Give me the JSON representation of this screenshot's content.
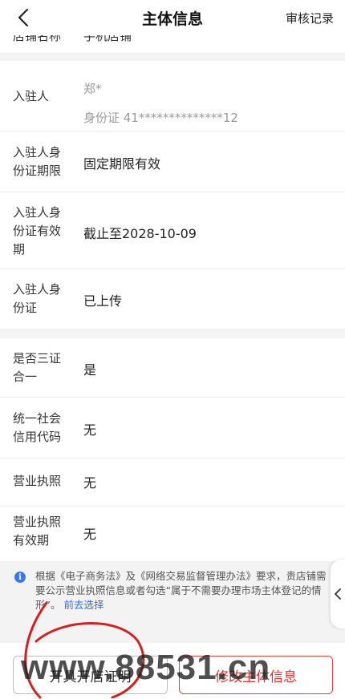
{
  "header": {
    "title": "主体信息",
    "audit_label": "审核记录"
  },
  "top_partial": {
    "label": "店铺名称",
    "value": "手机店铺"
  },
  "applicant": {
    "label": "入驻人",
    "name": "郑*",
    "id_info": "身份证 41**************12"
  },
  "id_validity_type": {
    "label": "入驻人身份证期限",
    "value": "固定期限有效"
  },
  "id_valid_until": {
    "label": "入驻人身份证有效期",
    "value": "截止至2028-10-09"
  },
  "id_card": {
    "label": "入驻人身份证",
    "value": "已上传"
  },
  "three_in_one": {
    "label": "是否三证合一",
    "value": "是"
  },
  "credit_code": {
    "label": "统一社会信用代码",
    "value": "无"
  },
  "business_license": {
    "label": "营业执照",
    "value": "无"
  },
  "license_validity": {
    "label": "营业执照有效期",
    "value": "无"
  },
  "notice": {
    "text": "根据《电子商务法》及《网络交易监督管理办法》要求，贵店铺需要公示营业执照信息或者勾选“属于不需要办理市场主体登记的情形”。",
    "link": "前去选择"
  },
  "buttons": {
    "left": "开具开店证明",
    "right": "修改主体信息"
  },
  "watermark": "www.88531.cn",
  "colors": {
    "accent_red": "#e03030",
    "link_blue": "#2f6fe8",
    "background": "#f3f3f3"
  }
}
